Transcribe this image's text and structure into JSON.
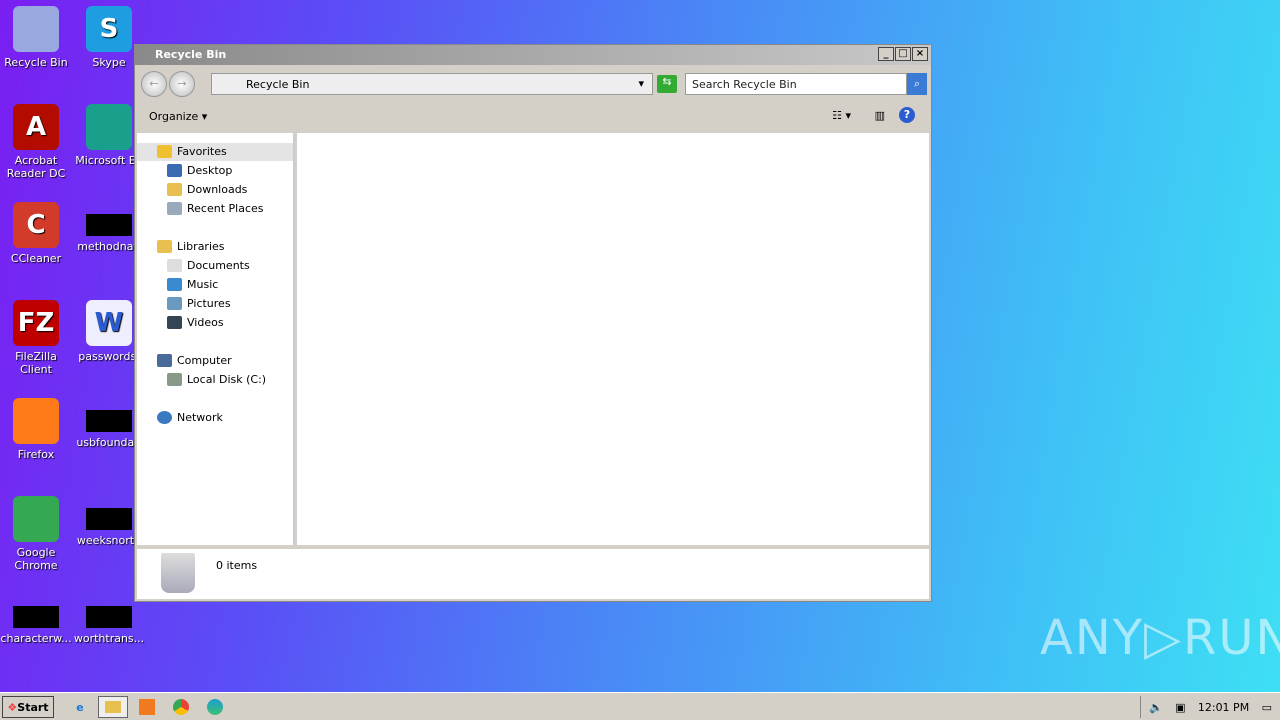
{
  "desktop": {
    "icons": [
      {
        "label": "Recycle Bin",
        "icon": "recycle-bin-icon",
        "color": "#9aa8e0"
      },
      {
        "label": "Skype",
        "icon": "skype-icon",
        "color": "#1e9de0",
        "glyph": "S"
      },
      {
        "label": "Acrobat Reader DC",
        "icon": "acrobat-icon",
        "color": "#b30b00",
        "glyph": "A"
      },
      {
        "label": "Microsoft Ed",
        "icon": "edge-icon",
        "color": "#1a9f8c"
      },
      {
        "label": "CCleaner",
        "icon": "ccleaner-icon",
        "color": "#d23a2a",
        "glyph": "C"
      },
      {
        "label": "methodnati",
        "icon": "file-icon"
      },
      {
        "label": "FileZilla Client",
        "icon": "filezilla-icon",
        "color": "#bf0000",
        "glyph": "FZ"
      },
      {
        "label": "passwords.",
        "icon": "word-doc-icon",
        "color": "#eef",
        "glyph": "W"
      },
      {
        "label": "Firefox",
        "icon": "firefox-icon",
        "color": "#ff7a18"
      },
      {
        "label": "usbfoundati",
        "icon": "file-icon"
      },
      {
        "label": "Google Chrome",
        "icon": "chrome-icon",
        "color": "#34a853"
      },
      {
        "label": "weeksnorth",
        "icon": "file-icon"
      },
      {
        "label": "characterw...",
        "icon": "file-icon"
      },
      {
        "label": "worthtrans...",
        "icon": "file-icon"
      }
    ]
  },
  "window": {
    "title": "Recycle Bin",
    "address": "Recycle Bin",
    "search_placeholder": "Search Recycle Bin",
    "organize": "Organize",
    "nav": {
      "favorites": "Favorites",
      "desktop": "Desktop",
      "downloads": "Downloads",
      "recent": "Recent Places",
      "libraries": "Libraries",
      "documents": "Documents",
      "music": "Music",
      "pictures": "Pictures",
      "videos": "Videos",
      "computer": "Computer",
      "local_disk": "Local Disk (C:)",
      "network": "Network"
    },
    "status": "0 items"
  },
  "taskbar": {
    "start": "Start",
    "clock": "12:01 PM"
  },
  "watermark": "ANY RUN"
}
